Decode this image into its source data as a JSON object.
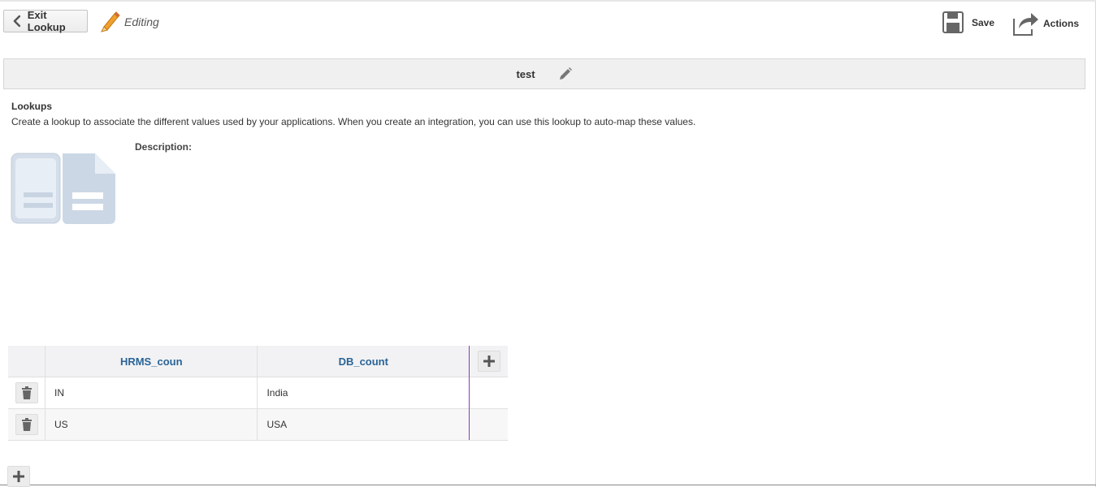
{
  "toolbar": {
    "exit_label": "Exit Lookup",
    "editing_label": "Editing",
    "save_label": "Save",
    "actions_label": "Actions"
  },
  "title": "test",
  "lookups": {
    "heading": "Lookups",
    "description": "Create a lookup to associate the different values used by your applications. When you create an integration, you can use this lookup to auto-map these values.",
    "description_label": "Description:"
  },
  "table": {
    "columns": [
      "HRMS_coun",
      "DB_count"
    ],
    "rows": [
      [
        "IN",
        "India"
      ],
      [
        "US",
        "USA"
      ]
    ]
  },
  "colors": {
    "accent": "#2a6496",
    "pencil": "#f0a030",
    "column_divider": "#8a3ab9",
    "icon_gray": "#666666",
    "doc_icon": "#cfd9e6"
  }
}
